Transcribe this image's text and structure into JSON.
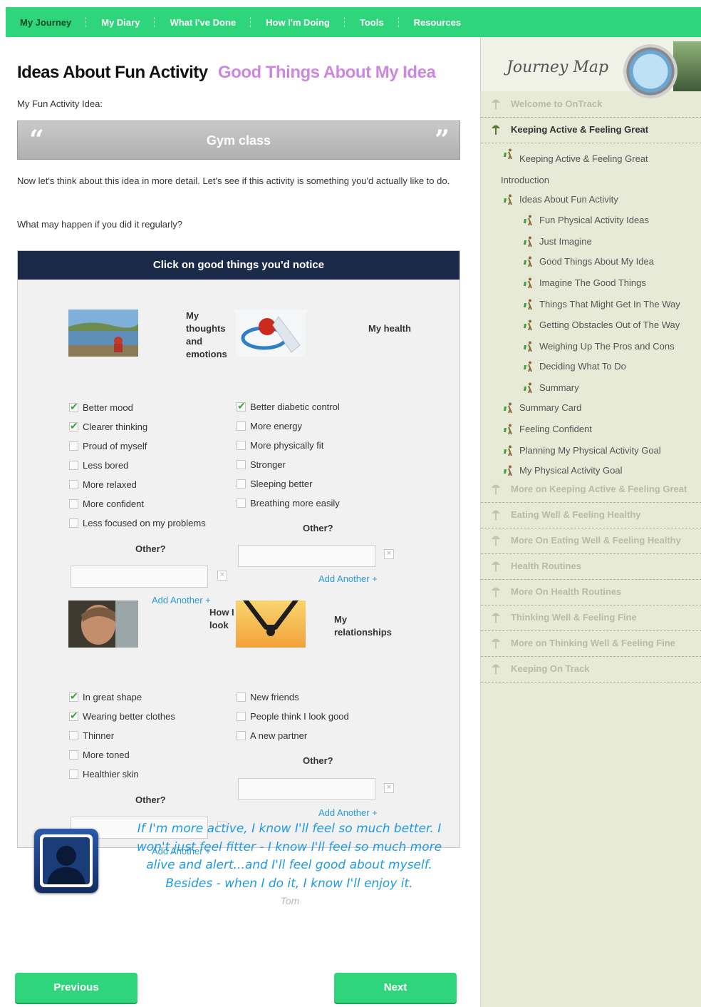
{
  "nav": {
    "items": [
      "My Journey",
      "My Diary",
      "What I've Done",
      "How I'm Doing",
      "Tools",
      "Resources"
    ],
    "active": "My Journey"
  },
  "page": {
    "title": "Ideas About Fun Activity",
    "subtitle": "Good Things About My Idea",
    "idea_label": "My Fun Activity Idea:",
    "idea_value": "Gym class",
    "intro": "Now let's think about this idea in more detail. Let's see if this activity is something you'd actually like to do.",
    "question": "What may happen if you did it regularly?"
  },
  "panel": {
    "header": "Click on good things you'd notice",
    "other_label": "Other?",
    "add_another": "Add Another +",
    "groups": {
      "thoughts": {
        "title": "My thoughts and emotions",
        "items": [
          {
            "label": "Better mood",
            "checked": true
          },
          {
            "label": "Clearer thinking",
            "checked": true
          },
          {
            "label": "Proud of myself",
            "checked": false
          },
          {
            "label": "Less bored",
            "checked": false
          },
          {
            "label": "More relaxed",
            "checked": false
          },
          {
            "label": "More confident",
            "checked": false
          },
          {
            "label": "Less focused on my problems",
            "checked": false
          }
        ]
      },
      "health": {
        "title": "My health",
        "items": [
          {
            "label": "Better diabetic control",
            "checked": true
          },
          {
            "label": "More energy",
            "checked": false
          },
          {
            "label": "More physically fit",
            "checked": false
          },
          {
            "label": "Stronger",
            "checked": false
          },
          {
            "label": "Sleeping better",
            "checked": false
          },
          {
            "label": "Breathing more easily",
            "checked": false
          }
        ]
      },
      "look": {
        "title": "How I look",
        "items": [
          {
            "label": "In great shape",
            "checked": true
          },
          {
            "label": "Wearing better clothes",
            "checked": true
          },
          {
            "label": "Thinner",
            "checked": false
          },
          {
            "label": "More toned",
            "checked": false
          },
          {
            "label": "Healthier skin",
            "checked": false
          }
        ]
      },
      "relationships": {
        "title": "My relationships",
        "items": [
          {
            "label": "New friends",
            "checked": false
          },
          {
            "label": "People think I look good",
            "checked": false
          },
          {
            "label": "A new partner",
            "checked": false
          }
        ]
      }
    }
  },
  "quote": {
    "text": "If I'm more active, I know I'll feel so much better. I won't just feel fitter - I know I'll feel so much more alive and alert...and I'll feel good about myself. Besides - when I do it, I know I'll enjoy it.",
    "author": "Tom"
  },
  "buttons": {
    "previous": "Previous",
    "next": "Next"
  },
  "sidebar": {
    "title": "Journey Map",
    "sections": [
      {
        "label": "Welcome to OnTrack",
        "active": false
      },
      {
        "label": "Keeping Active & Feeling Great",
        "active": true
      },
      {
        "label": "More on Keeping Active & Feeling Great",
        "active": false
      },
      {
        "label": "Eating Well & Feeling Healthy",
        "active": false
      },
      {
        "label": "More On Eating Well & Feeling Healthy",
        "active": false
      },
      {
        "label": "Health Routines",
        "active": false
      },
      {
        "label": "More On Health Routines",
        "active": false
      },
      {
        "label": "Thinking Well & Feeling Fine",
        "active": false
      },
      {
        "label": "More on Thinking Well & Feeling Fine",
        "active": false
      },
      {
        "label": "Keeping On Track",
        "active": false
      }
    ],
    "subitems": [
      {
        "label": "Keeping Active & Feeling Great Introduction",
        "level": 1
      },
      {
        "label": "Ideas About Fun Activity",
        "level": 1,
        "current": true
      },
      {
        "label": "Fun Physical Activity Ideas",
        "level": 2
      },
      {
        "label": "Just Imagine",
        "level": 2
      },
      {
        "label": "Good Things About My Idea",
        "level": 2,
        "current": true
      },
      {
        "label": "Imagine The Good Things",
        "level": 2
      },
      {
        "label": "Things That Might Get In The Way",
        "level": 2
      },
      {
        "label": "Getting Obstacles Out of The Way",
        "level": 2
      },
      {
        "label": "Weighing Up The Pros and Cons",
        "level": 2
      },
      {
        "label": "Deciding What To Do",
        "level": 2
      },
      {
        "label": "Summary",
        "level": 2
      },
      {
        "label": "Summary Card",
        "level": 1
      },
      {
        "label": "Feeling Confident",
        "level": 1
      },
      {
        "label": "Planning My Physical Activity Goal",
        "level": 1
      },
      {
        "label": "My Physical Activity Goal",
        "level": 1
      }
    ]
  },
  "colors": {
    "nav_green": "#2fd57a",
    "panel_header": "#1c2a4a",
    "subtitle": "#cc88dd",
    "link_blue": "#2a9ad6",
    "quote_blue": "#1e9be8",
    "sidebar_bg": "#e6ead6"
  }
}
